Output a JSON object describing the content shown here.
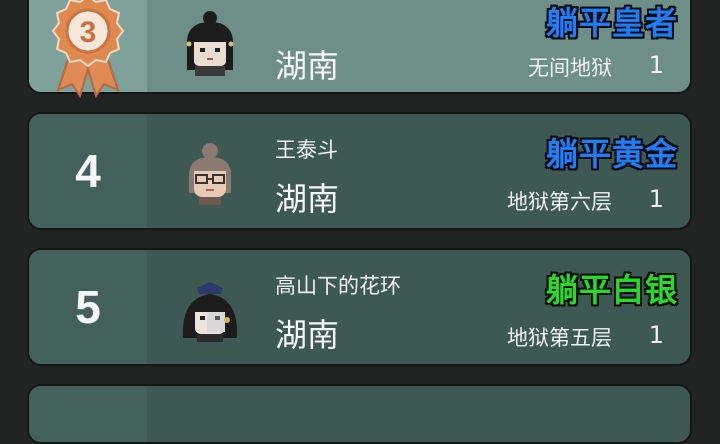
{
  "rows": [
    {
      "rank": "3",
      "name": "",
      "region": "湖南",
      "title": "躺平皇者",
      "title_color": "#1f7dff",
      "level": "无间地狱",
      "count": "1",
      "avatar": "bun-hair-girl-icon"
    },
    {
      "rank": "4",
      "name": "王泰斗",
      "region": "湖南",
      "title": "躺平黄金",
      "title_color": "#1f7dff",
      "level": "地狱第六层",
      "count": "1",
      "avatar": "glasses-granny-icon"
    },
    {
      "rank": "5",
      "name": "高山下的花环",
      "region": "湖南",
      "title": "躺平白银",
      "title_color": "#29d92a",
      "level": "地狱第五层",
      "count": "1",
      "avatar": "masked-hair-girl-icon"
    }
  ],
  "medal_icon": "bronze-medal-icon"
}
